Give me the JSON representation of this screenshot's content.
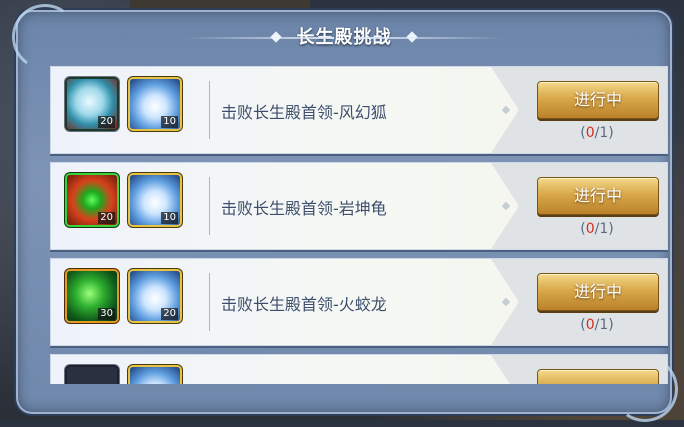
{
  "header": {
    "title": "长生殿挑战"
  },
  "challenges": [
    {
      "reward_1": {
        "icon": "crystal-icon",
        "count": "20"
      },
      "reward_2": {
        "icon": "lotus-icon",
        "count": "10"
      },
      "description": "击败长生殿首领-风幻狐",
      "button_label": "进行中",
      "progress_open": "(",
      "progress_current": "0",
      "progress_total": "/1)"
    },
    {
      "reward_1": {
        "icon": "orb-icon",
        "count": "20"
      },
      "reward_2": {
        "icon": "lotus-icon",
        "count": "10"
      },
      "description": "击败长生殿首领-岩坤龟",
      "button_label": "进行中",
      "progress_open": "(",
      "progress_current": "0",
      "progress_total": "/1)"
    },
    {
      "reward_1": {
        "icon": "leaf-crystal-icon",
        "count": "30"
      },
      "reward_2": {
        "icon": "lotus-icon",
        "count": "20"
      },
      "description": "击败长生殿首领-火蛟龙",
      "button_label": "进行中",
      "progress_open": "(",
      "progress_current": "0",
      "progress_total": "/1)"
    }
  ],
  "colors": {
    "panel": "#7d94b6",
    "button": "#d9a84a",
    "progress_current": "#d0311e",
    "description": "#3e4f6e"
  }
}
